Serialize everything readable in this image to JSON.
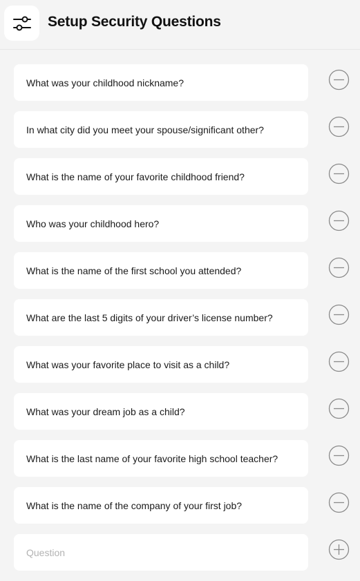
{
  "header": {
    "title": "Setup Security Questions",
    "icon": "sliders-icon"
  },
  "questions": [
    "What was your childhood nickname?",
    "In what city did you meet your spouse/significant other?",
    "What is the name of your favorite childhood friend?",
    "Who was your childhood hero?",
    "What is the name of the first school you attended?",
    "What are the last 5 digits of your driver’s license number?",
    "What was your favorite place to visit as a child?",
    "What was your dream job as a child?",
    "What is the last name of your favorite high school teacher?",
    "What is the name of the company of your first job?"
  ],
  "new_question": {
    "placeholder": "Question",
    "value": ""
  },
  "icons": {
    "remove": "minus-circle-icon",
    "add": "plus-circle-icon"
  },
  "colors": {
    "background": "#f4f4f4",
    "card": "#ffffff",
    "text": "#1a1a1a",
    "placeholder": "#b3b3b3",
    "icon_stroke": "#8a8a8a"
  }
}
